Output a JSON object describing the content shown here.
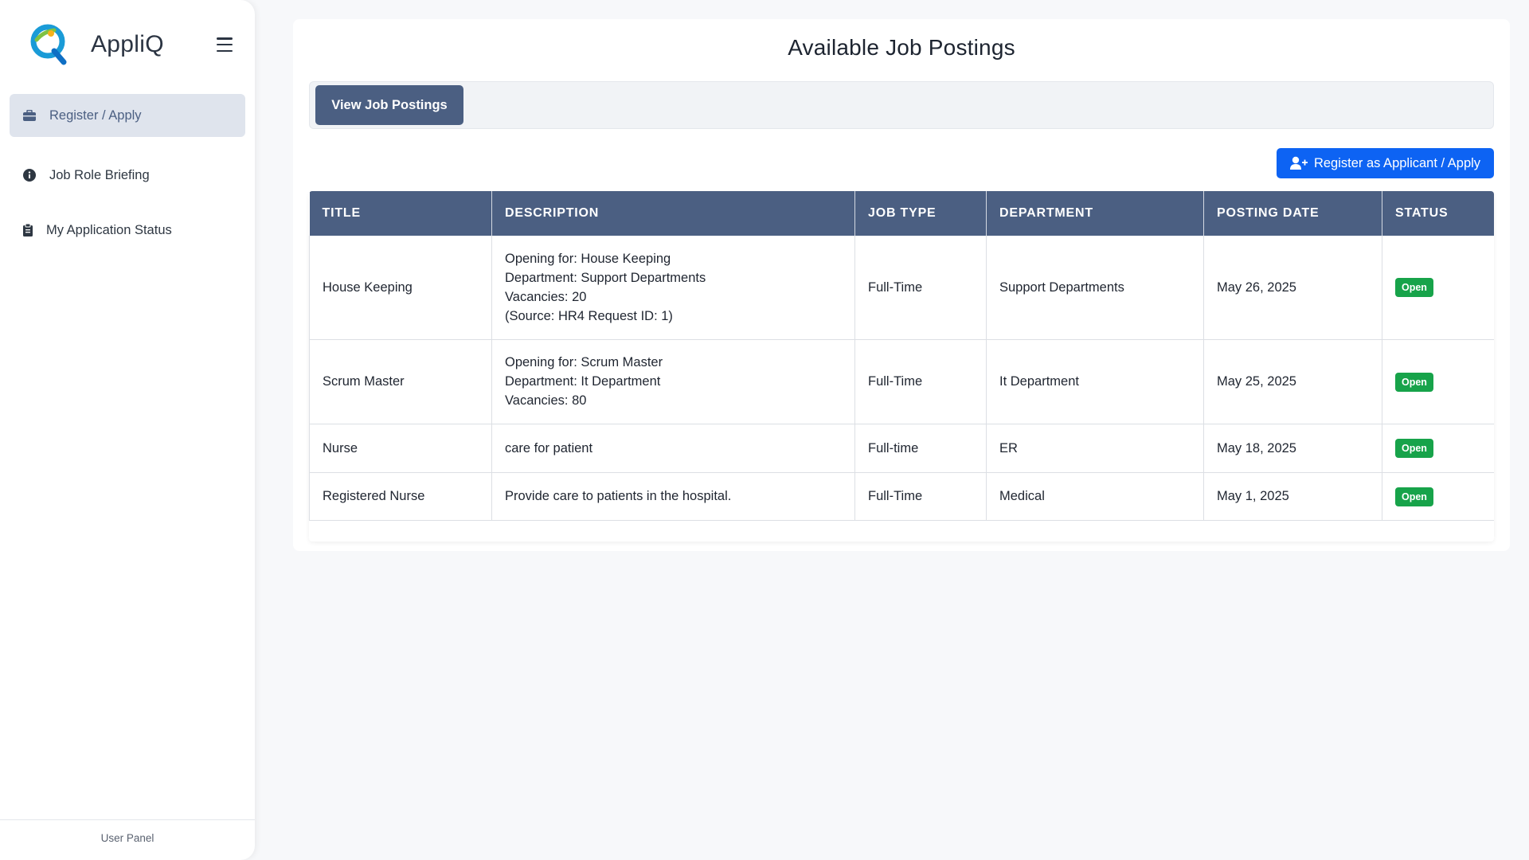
{
  "app": {
    "name": "AppliQ",
    "footer": "User Panel"
  },
  "sidebar": {
    "items": [
      {
        "label": "Register / Apply",
        "icon": "briefcase-icon",
        "active": true
      },
      {
        "label": "Job Role Briefing",
        "icon": "info-circle-icon",
        "active": false
      },
      {
        "label": "My Application Status",
        "icon": "clipboard-icon",
        "active": false
      }
    ]
  },
  "main": {
    "title": "Available Job Postings",
    "tabs": [
      {
        "label": "View Job Postings",
        "active": true
      }
    ],
    "apply_button": "Register as Applicant / Apply",
    "table": {
      "columns": [
        "TITLE",
        "DESCRIPTION",
        "JOB TYPE",
        "DEPARTMENT",
        "POSTING DATE",
        "STATUS"
      ],
      "rows": [
        {
          "title": "House Keeping",
          "description": [
            "Opening for: House Keeping",
            "Department: Support Departments",
            "Vacancies: 20",
            "(Source: HR4 Request ID: 1)"
          ],
          "job_type": "Full-Time",
          "department": "Support Departments",
          "posting_date": "May 26, 2025",
          "status": "Open"
        },
        {
          "title": "Scrum Master",
          "description": [
            "Opening for: Scrum Master",
            "Department: It Department",
            "Vacancies: 80"
          ],
          "job_type": "Full-Time",
          "department": "It Department",
          "posting_date": "May 25, 2025",
          "status": "Open"
        },
        {
          "title": "Nurse",
          "description": [
            "care for patient"
          ],
          "job_type": "Full-time",
          "department": "ER",
          "posting_date": "May 18, 2025",
          "status": "Open"
        },
        {
          "title": "Registered Nurse",
          "description": [
            "Provide care to patients in the hospital."
          ],
          "job_type": "Full-Time",
          "department": "Medical",
          "posting_date": "May 1, 2025",
          "status": "Open"
        }
      ]
    }
  },
  "colors": {
    "accent": "#4b5f82",
    "primary_button": "#0d63f3",
    "status_open": "#17a34a",
    "active_nav_bg": "#dfe4ed"
  }
}
